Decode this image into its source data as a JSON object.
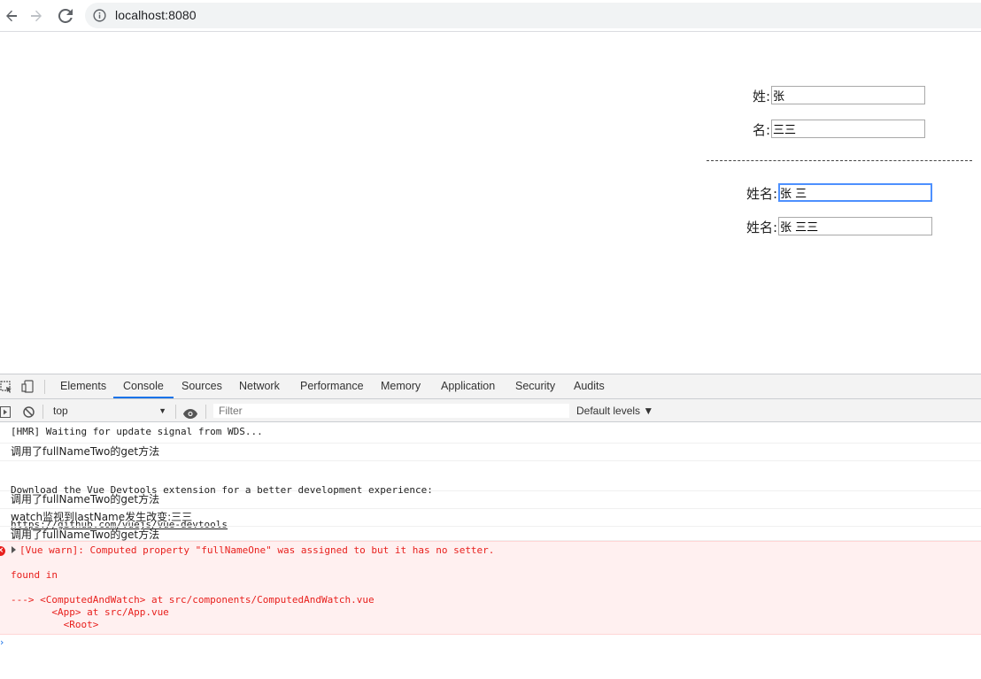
{
  "browser": {
    "url": "localhost:8080",
    "icons": [
      "back-arrow-icon",
      "forward-arrow-icon",
      "reload-icon",
      "info-icon"
    ]
  },
  "form": {
    "last_name_label": "姓:",
    "last_name_value": "张",
    "first_name_label": "名:",
    "first_name_value": "三三",
    "full_name_one_label": "姓名:",
    "full_name_one_value": "张 三",
    "full_name_two_label": "姓名:",
    "full_name_two_value": "张 三三"
  },
  "devtools": {
    "tabs": [
      "Elements",
      "Console",
      "Sources",
      "Network",
      "Performance",
      "Memory",
      "Application",
      "Security",
      "Audits"
    ],
    "active_tab": "Console",
    "context": "top",
    "filter_placeholder": "Filter",
    "levels": "Default levels ▼",
    "accent_color": "#1a73e8"
  },
  "console": {
    "logs": [
      "[HMR] Waiting for update signal from WDS...",
      "调用了fullNameTwo的get方法",
      "Download the Vue Devtools extension for a better development experience:",
      "https://github.com/vuejs/vue-devtools",
      "调用了fullNameTwo的get方法",
      "watch监视到lastName发生改变:三三",
      "调用了fullNameTwo的get方法"
    ],
    "error": {
      "message": "[Vue warn]: Computed property \"fullNameOne\" was assigned to but it has no setter.",
      "found_in": "found in",
      "trace_1": "---> <ComputedAndWatch> at src/components/ComputedAndWatch.vue",
      "trace_2": "       <App> at src/App.vue",
      "trace_3": "         <Root>",
      "color": "#e8201d"
    },
    "prompt": "›"
  }
}
